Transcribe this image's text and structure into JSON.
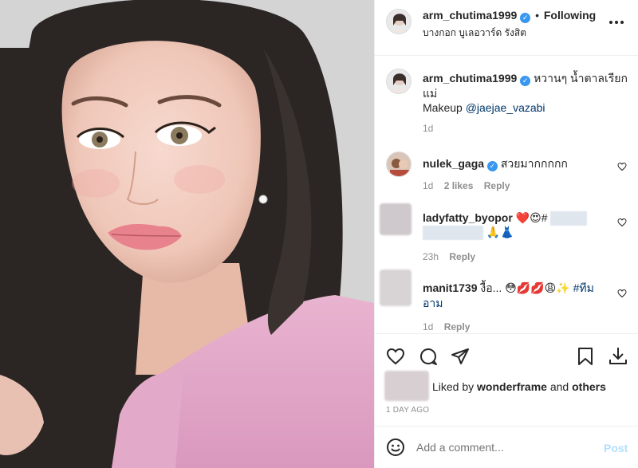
{
  "post": {
    "username": "arm_chutima1999",
    "follow_status": "Following",
    "separator": "•",
    "location": "บางกอก บูเลอวาร์ด รังสิต",
    "more_icon": "more-horizontal-icon",
    "caption": {
      "username": "arm_chutima1999",
      "text_line1": "หวานๆ น้ำตาลเรียก",
      "text_line2": "แม่",
      "makeup_label": "Makeup",
      "makeup_mention": "@jaejae_vazabi",
      "time": "1d"
    }
  },
  "comments": [
    {
      "username": "nulek_gaga",
      "verified": true,
      "text": "สวยมากกกกก",
      "time": "1d",
      "likes": "2 likes",
      "reply": "Reply"
    },
    {
      "username": "ladyfatty_byopor",
      "text": "❤️😍#",
      "text2": "🙏👗",
      "time": "23h",
      "reply": "Reply"
    },
    {
      "username": "manit1739",
      "text": "งื้อ... 😳💋💋😩✨",
      "hashtag_part1": "#ทีม",
      "hashtag_part2": "อาม",
      "time": "1d",
      "reply": "Reply"
    }
  ],
  "engagement": {
    "liked_prefix": "Liked by",
    "liked_user": "wonderframe",
    "liked_and": "and",
    "liked_others": "others",
    "date": "1 DAY AGO"
  },
  "add_comment": {
    "placeholder": "Add a comment...",
    "post_label": "Post"
  },
  "colors": {
    "accent_blue": "#0095f6",
    "verified_blue": "#3897f0",
    "muted": "#8e8e8e",
    "link": "#00376b"
  }
}
